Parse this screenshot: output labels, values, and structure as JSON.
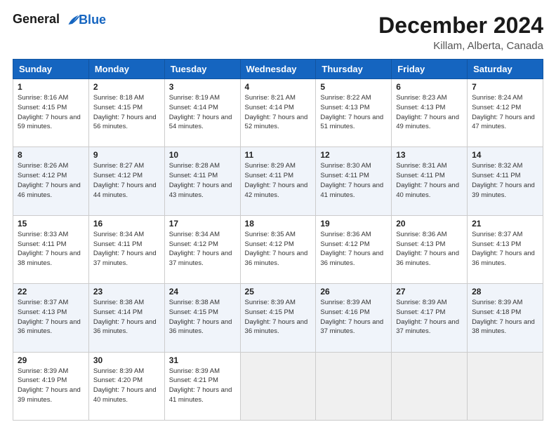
{
  "header": {
    "logo_line1": "General",
    "logo_line2": "Blue",
    "month_title": "December 2024",
    "location": "Killam, Alberta, Canada"
  },
  "weekdays": [
    "Sunday",
    "Monday",
    "Tuesday",
    "Wednesday",
    "Thursday",
    "Friday",
    "Saturday"
  ],
  "weeks": [
    [
      {
        "day": "1",
        "info": "Sunrise: 8:16 AM\nSunset: 4:15 PM\nDaylight: 7 hours and 59 minutes."
      },
      {
        "day": "2",
        "info": "Sunrise: 8:18 AM\nSunset: 4:15 PM\nDaylight: 7 hours and 56 minutes."
      },
      {
        "day": "3",
        "info": "Sunrise: 8:19 AM\nSunset: 4:14 PM\nDaylight: 7 hours and 54 minutes."
      },
      {
        "day": "4",
        "info": "Sunrise: 8:21 AM\nSunset: 4:14 PM\nDaylight: 7 hours and 52 minutes."
      },
      {
        "day": "5",
        "info": "Sunrise: 8:22 AM\nSunset: 4:13 PM\nDaylight: 7 hours and 51 minutes."
      },
      {
        "day": "6",
        "info": "Sunrise: 8:23 AM\nSunset: 4:13 PM\nDaylight: 7 hours and 49 minutes."
      },
      {
        "day": "7",
        "info": "Sunrise: 8:24 AM\nSunset: 4:12 PM\nDaylight: 7 hours and 47 minutes."
      }
    ],
    [
      {
        "day": "8",
        "info": "Sunrise: 8:26 AM\nSunset: 4:12 PM\nDaylight: 7 hours and 46 minutes."
      },
      {
        "day": "9",
        "info": "Sunrise: 8:27 AM\nSunset: 4:12 PM\nDaylight: 7 hours and 44 minutes."
      },
      {
        "day": "10",
        "info": "Sunrise: 8:28 AM\nSunset: 4:11 PM\nDaylight: 7 hours and 43 minutes."
      },
      {
        "day": "11",
        "info": "Sunrise: 8:29 AM\nSunset: 4:11 PM\nDaylight: 7 hours and 42 minutes."
      },
      {
        "day": "12",
        "info": "Sunrise: 8:30 AM\nSunset: 4:11 PM\nDaylight: 7 hours and 41 minutes."
      },
      {
        "day": "13",
        "info": "Sunrise: 8:31 AM\nSunset: 4:11 PM\nDaylight: 7 hours and 40 minutes."
      },
      {
        "day": "14",
        "info": "Sunrise: 8:32 AM\nSunset: 4:11 PM\nDaylight: 7 hours and 39 minutes."
      }
    ],
    [
      {
        "day": "15",
        "info": "Sunrise: 8:33 AM\nSunset: 4:11 PM\nDaylight: 7 hours and 38 minutes."
      },
      {
        "day": "16",
        "info": "Sunrise: 8:34 AM\nSunset: 4:11 PM\nDaylight: 7 hours and 37 minutes."
      },
      {
        "day": "17",
        "info": "Sunrise: 8:34 AM\nSunset: 4:12 PM\nDaylight: 7 hours and 37 minutes."
      },
      {
        "day": "18",
        "info": "Sunrise: 8:35 AM\nSunset: 4:12 PM\nDaylight: 7 hours and 36 minutes."
      },
      {
        "day": "19",
        "info": "Sunrise: 8:36 AM\nSunset: 4:12 PM\nDaylight: 7 hours and 36 minutes."
      },
      {
        "day": "20",
        "info": "Sunrise: 8:36 AM\nSunset: 4:13 PM\nDaylight: 7 hours and 36 minutes."
      },
      {
        "day": "21",
        "info": "Sunrise: 8:37 AM\nSunset: 4:13 PM\nDaylight: 7 hours and 36 minutes."
      }
    ],
    [
      {
        "day": "22",
        "info": "Sunrise: 8:37 AM\nSunset: 4:13 PM\nDaylight: 7 hours and 36 minutes."
      },
      {
        "day": "23",
        "info": "Sunrise: 8:38 AM\nSunset: 4:14 PM\nDaylight: 7 hours and 36 minutes."
      },
      {
        "day": "24",
        "info": "Sunrise: 8:38 AM\nSunset: 4:15 PM\nDaylight: 7 hours and 36 minutes."
      },
      {
        "day": "25",
        "info": "Sunrise: 8:39 AM\nSunset: 4:15 PM\nDaylight: 7 hours and 36 minutes."
      },
      {
        "day": "26",
        "info": "Sunrise: 8:39 AM\nSunset: 4:16 PM\nDaylight: 7 hours and 37 minutes."
      },
      {
        "day": "27",
        "info": "Sunrise: 8:39 AM\nSunset: 4:17 PM\nDaylight: 7 hours and 37 minutes."
      },
      {
        "day": "28",
        "info": "Sunrise: 8:39 AM\nSunset: 4:18 PM\nDaylight: 7 hours and 38 minutes."
      }
    ],
    [
      {
        "day": "29",
        "info": "Sunrise: 8:39 AM\nSunset: 4:19 PM\nDaylight: 7 hours and 39 minutes."
      },
      {
        "day": "30",
        "info": "Sunrise: 8:39 AM\nSunset: 4:20 PM\nDaylight: 7 hours and 40 minutes."
      },
      {
        "day": "31",
        "info": "Sunrise: 8:39 AM\nSunset: 4:21 PM\nDaylight: 7 hours and 41 minutes."
      },
      null,
      null,
      null,
      null
    ]
  ]
}
